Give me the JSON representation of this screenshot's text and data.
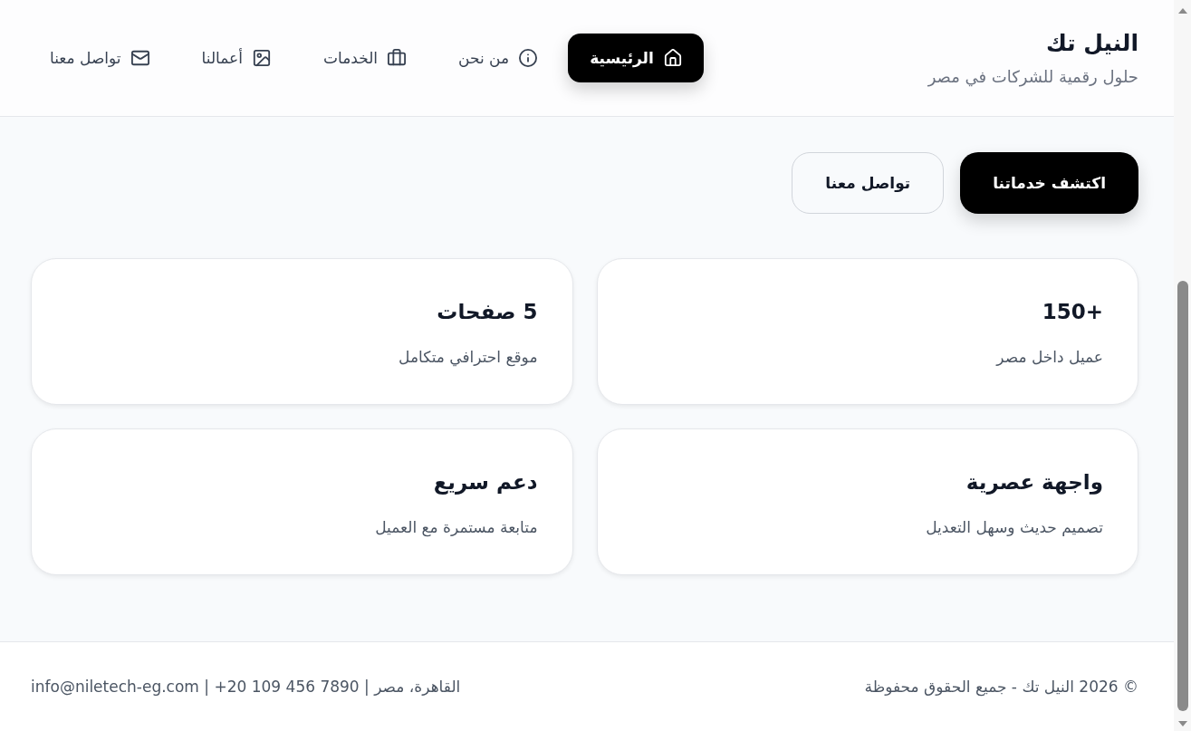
{
  "header": {
    "brand": "النيل تك",
    "tagline": "حلول رقمية للشركات في مصر",
    "nav": [
      {
        "label": "الرئيسية",
        "selected": true
      },
      {
        "label": "من نحن",
        "selected": false
      },
      {
        "label": "الخدمات",
        "selected": false
      },
      {
        "label": "أعمالنا",
        "selected": false
      },
      {
        "label": "تواصل معنا",
        "selected": false
      }
    ]
  },
  "hero": {
    "buttons": [
      {
        "label": "اكتشف خدماتنا",
        "kind": "primary"
      },
      {
        "label": "تواصل معنا",
        "kind": "secondary"
      }
    ]
  },
  "stats": [
    {
      "title": "150+",
      "text": "عميل داخل مصر"
    },
    {
      "title": "5 صفحات",
      "text": "موقع احترافي متكامل"
    },
    {
      "title": "واجهة عصرية",
      "text": "تصميم حديث وسهل التعديل"
    },
    {
      "title": "دعم سريع",
      "text": "متابعة مستمرة مع العميل"
    }
  ],
  "footer": {
    "copyright": "© 2026 النيل تك - جميع الحقوق محفوظة",
    "contact": "info@niletech-eg.com | +20 109 456 7890 | القاهرة، مصر"
  }
}
